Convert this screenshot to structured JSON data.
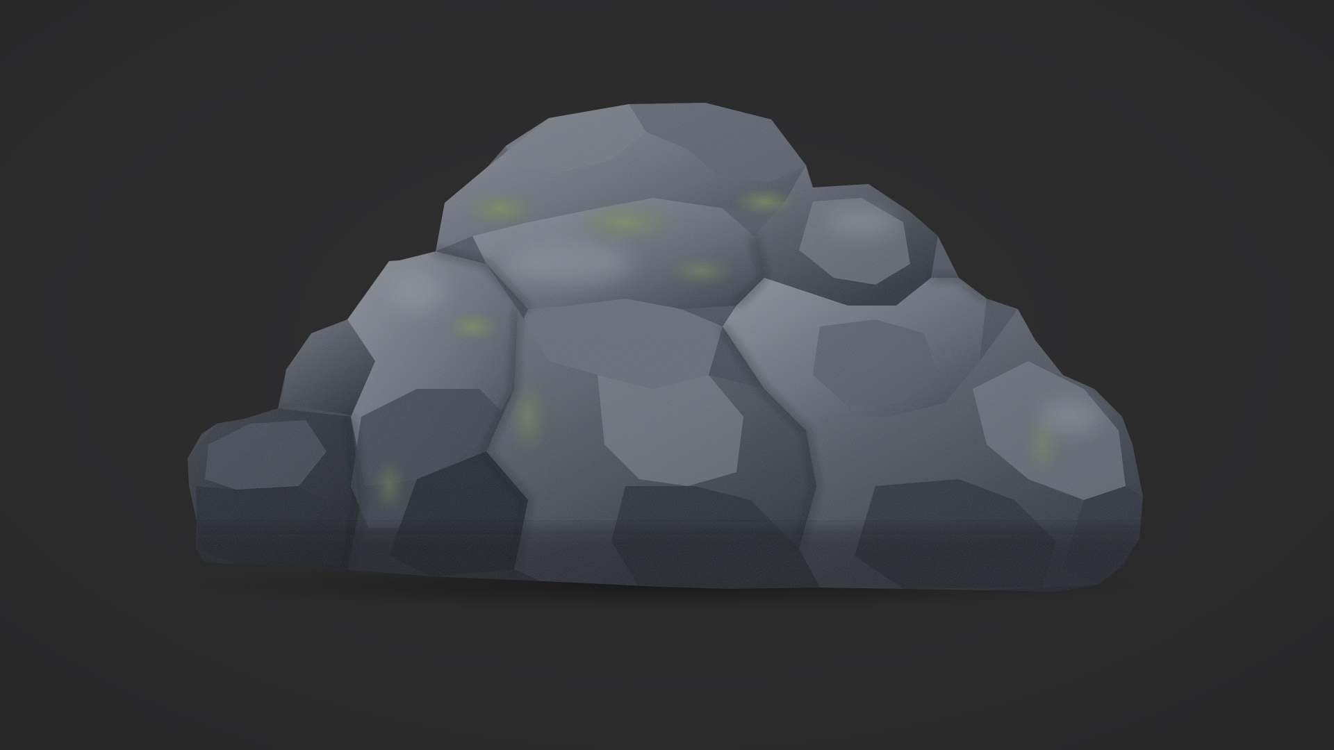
{
  "scene": {
    "subject": "rock-boulder",
    "background_color": "#2b2b2c",
    "colors": {
      "rock_base": "#3f4450",
      "rock_light": "#7f858f",
      "rock_dark": "#1c1f26",
      "moss": "#6f7d52",
      "shadow": "#1d1d1e"
    }
  }
}
